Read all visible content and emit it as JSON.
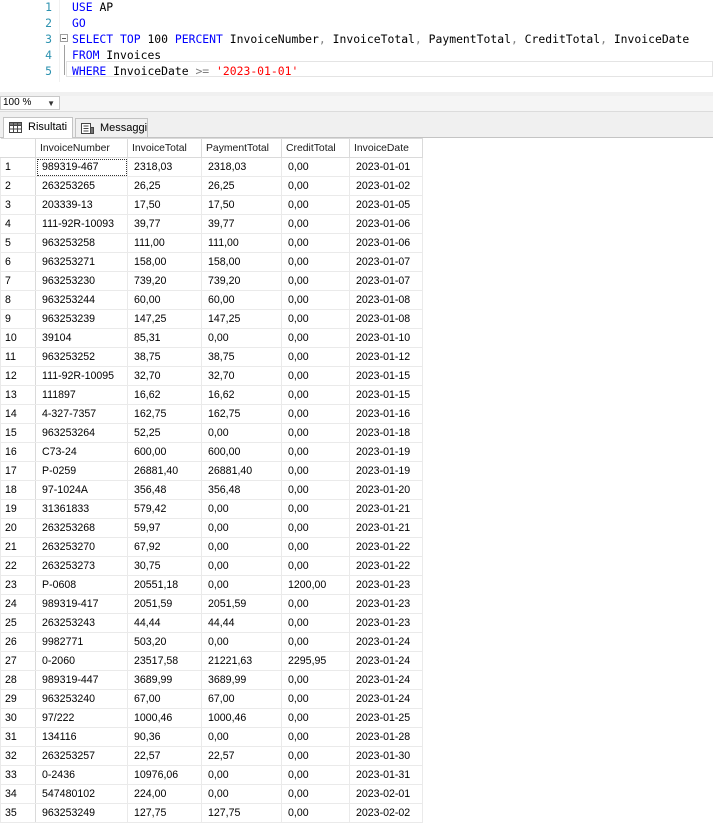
{
  "editor": {
    "lines": [
      {
        "num": "1",
        "tokens": [
          {
            "t": "USE ",
            "c": "kw"
          },
          {
            "t": "AP",
            "c": ""
          }
        ]
      },
      {
        "num": "2",
        "tokens": [
          {
            "t": "GO",
            "c": "kw"
          }
        ]
      },
      {
        "num": "3",
        "tokens": [
          {
            "t": "SELECT TOP ",
            "c": "kw"
          },
          {
            "t": "100 ",
            "c": ""
          },
          {
            "t": "PERCENT ",
            "c": "kw"
          },
          {
            "t": "InvoiceNumber",
            "c": ""
          },
          {
            "t": ", ",
            "c": "gray"
          },
          {
            "t": "InvoiceTotal",
            "c": ""
          },
          {
            "t": ", ",
            "c": "gray"
          },
          {
            "t": "PaymentTotal",
            "c": ""
          },
          {
            "t": ", ",
            "c": "gray"
          },
          {
            "t": "CreditTotal",
            "c": ""
          },
          {
            "t": ", ",
            "c": "gray"
          },
          {
            "t": "InvoiceDate",
            "c": ""
          }
        ]
      },
      {
        "num": "4",
        "tokens": [
          {
            "t": "FROM ",
            "c": "kw"
          },
          {
            "t": "Invoices",
            "c": ""
          }
        ]
      },
      {
        "num": "5",
        "tokens": [
          {
            "t": "WHERE ",
            "c": "kw"
          },
          {
            "t": "InvoiceDate ",
            "c": ""
          },
          {
            "t": ">= ",
            "c": "gray"
          },
          {
            "t": "'2023-01-01'",
            "c": "str"
          }
        ]
      }
    ]
  },
  "zoom": {
    "value": "100 %"
  },
  "tabs": {
    "results": "Risultati",
    "messages": "Messaggi"
  },
  "grid": {
    "columns": [
      "InvoiceNumber",
      "InvoiceTotal",
      "PaymentTotal",
      "CreditTotal",
      "InvoiceDate"
    ],
    "rows": [
      [
        "1",
        "989319-467",
        "2318,03",
        "2318,03",
        "0,00",
        "2023-01-01"
      ],
      [
        "2",
        "263253265",
        "26,25",
        "26,25",
        "0,00",
        "2023-01-02"
      ],
      [
        "3",
        "203339-13",
        "17,50",
        "17,50",
        "0,00",
        "2023-01-05"
      ],
      [
        "4",
        "111-92R-10093",
        "39,77",
        "39,77",
        "0,00",
        "2023-01-06"
      ],
      [
        "5",
        "963253258",
        "111,00",
        "111,00",
        "0,00",
        "2023-01-06"
      ],
      [
        "6",
        "963253271",
        "158,00",
        "158,00",
        "0,00",
        "2023-01-07"
      ],
      [
        "7",
        "963253230",
        "739,20",
        "739,20",
        "0,00",
        "2023-01-07"
      ],
      [
        "8",
        "963253244",
        "60,00",
        "60,00",
        "0,00",
        "2023-01-08"
      ],
      [
        "9",
        "963253239",
        "147,25",
        "147,25",
        "0,00",
        "2023-01-08"
      ],
      [
        "10",
        "39104",
        "85,31",
        "0,00",
        "0,00",
        "2023-01-10"
      ],
      [
        "11",
        "963253252",
        "38,75",
        "38,75",
        "0,00",
        "2023-01-12"
      ],
      [
        "12",
        "111-92R-10095",
        "32,70",
        "32,70",
        "0,00",
        "2023-01-15"
      ],
      [
        "13",
        "111897",
        "16,62",
        "16,62",
        "0,00",
        "2023-01-15"
      ],
      [
        "14",
        "4-327-7357",
        "162,75",
        "162,75",
        "0,00",
        "2023-01-16"
      ],
      [
        "15",
        "963253264",
        "52,25",
        "0,00",
        "0,00",
        "2023-01-18"
      ],
      [
        "16",
        "C73-24",
        "600,00",
        "600,00",
        "0,00",
        "2023-01-19"
      ],
      [
        "17",
        "P-0259",
        "26881,40",
        "26881,40",
        "0,00",
        "2023-01-19"
      ],
      [
        "18",
        "97-1024A",
        "356,48",
        "356,48",
        "0,00",
        "2023-01-20"
      ],
      [
        "19",
        "31361833",
        "579,42",
        "0,00",
        "0,00",
        "2023-01-21"
      ],
      [
        "20",
        "263253268",
        "59,97",
        "0,00",
        "0,00",
        "2023-01-21"
      ],
      [
        "21",
        "263253270",
        "67,92",
        "0,00",
        "0,00",
        "2023-01-22"
      ],
      [
        "22",
        "263253273",
        "30,75",
        "0,00",
        "0,00",
        "2023-01-22"
      ],
      [
        "23",
        "P-0608",
        "20551,18",
        "0,00",
        "1200,00",
        "2023-01-23"
      ],
      [
        "24",
        "989319-417",
        "2051,59",
        "2051,59",
        "0,00",
        "2023-01-23"
      ],
      [
        "25",
        "263253243",
        "44,44",
        "44,44",
        "0,00",
        "2023-01-23"
      ],
      [
        "26",
        "9982771",
        "503,20",
        "0,00",
        "0,00",
        "2023-01-24"
      ],
      [
        "27",
        "0-2060",
        "23517,58",
        "21221,63",
        "2295,95",
        "2023-01-24"
      ],
      [
        "28",
        "989319-447",
        "3689,99",
        "3689,99",
        "0,00",
        "2023-01-24"
      ],
      [
        "29",
        "963253240",
        "67,00",
        "67,00",
        "0,00",
        "2023-01-24"
      ],
      [
        "30",
        "97/222",
        "1000,46",
        "1000,46",
        "0,00",
        "2023-01-25"
      ],
      [
        "31",
        "134116",
        "90,36",
        "0,00",
        "0,00",
        "2023-01-28"
      ],
      [
        "32",
        "263253257",
        "22,57",
        "22,57",
        "0,00",
        "2023-01-30"
      ],
      [
        "33",
        "0-2436",
        "10976,06",
        "0,00",
        "0,00",
        "2023-01-31"
      ],
      [
        "34",
        "547480102",
        "224,00",
        "0,00",
        "0,00",
        "2023-02-01"
      ],
      [
        "35",
        "963253249",
        "127,75",
        "127,75",
        "0,00",
        "2023-02-02"
      ]
    ]
  }
}
